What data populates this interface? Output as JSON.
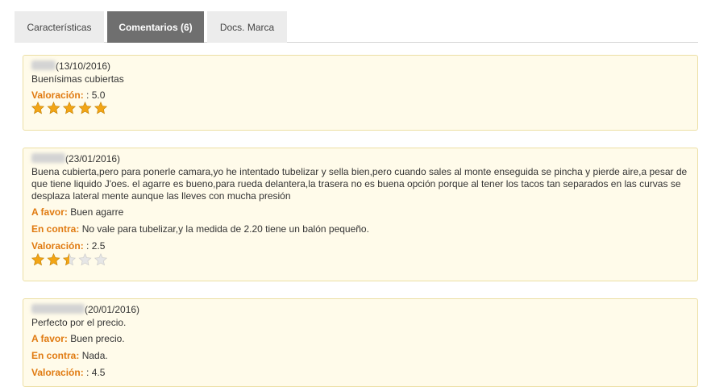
{
  "tabs": [
    {
      "label": "Características",
      "active": false
    },
    {
      "label": "Comentarios (6)",
      "active": true
    },
    {
      "label": "Docs. Marca",
      "active": false
    }
  ],
  "labels": {
    "rating": "Valoración:",
    "pros": "A favor:",
    "cons": "En contra:"
  },
  "reviews": [
    {
      "date": "(13/10/2016)",
      "text": "Buenísimas cubiertas",
      "rating_text": ": 5.0",
      "rating": 5.0
    },
    {
      "date": "(23/01/2016)",
      "text": "Buena cubierta,pero para ponerle camara,yo he intentado tubelizar y sella bien,pero cuando sales al monte enseguida se pincha y pierde aire,a pesar de que tiene liquido J'oes. el agarre es bueno,para rueda delantera,la trasera no es buena opción porque al tener los tacos tan separados en las curvas se desplaza lateral mente aunque las lleves con mucha presión",
      "pros": "Buen agarre",
      "cons": "No vale para tubelizar,y la medida de 2.20 tiene un balón pequeño.",
      "rating_text": ": 2.5",
      "rating": 2.5
    },
    {
      "date": "(20/01/2016)",
      "text": "Perfecto por el precio.",
      "pros": "Buen precio.",
      "cons": "Nada.",
      "rating_text": ": 4.5",
      "rating": 4.5
    }
  ],
  "colors": {
    "star_filled": "#f2a516",
    "star_empty": "#e6e6e6",
    "label": "#e07a10",
    "card_bg": "#fffbea"
  }
}
